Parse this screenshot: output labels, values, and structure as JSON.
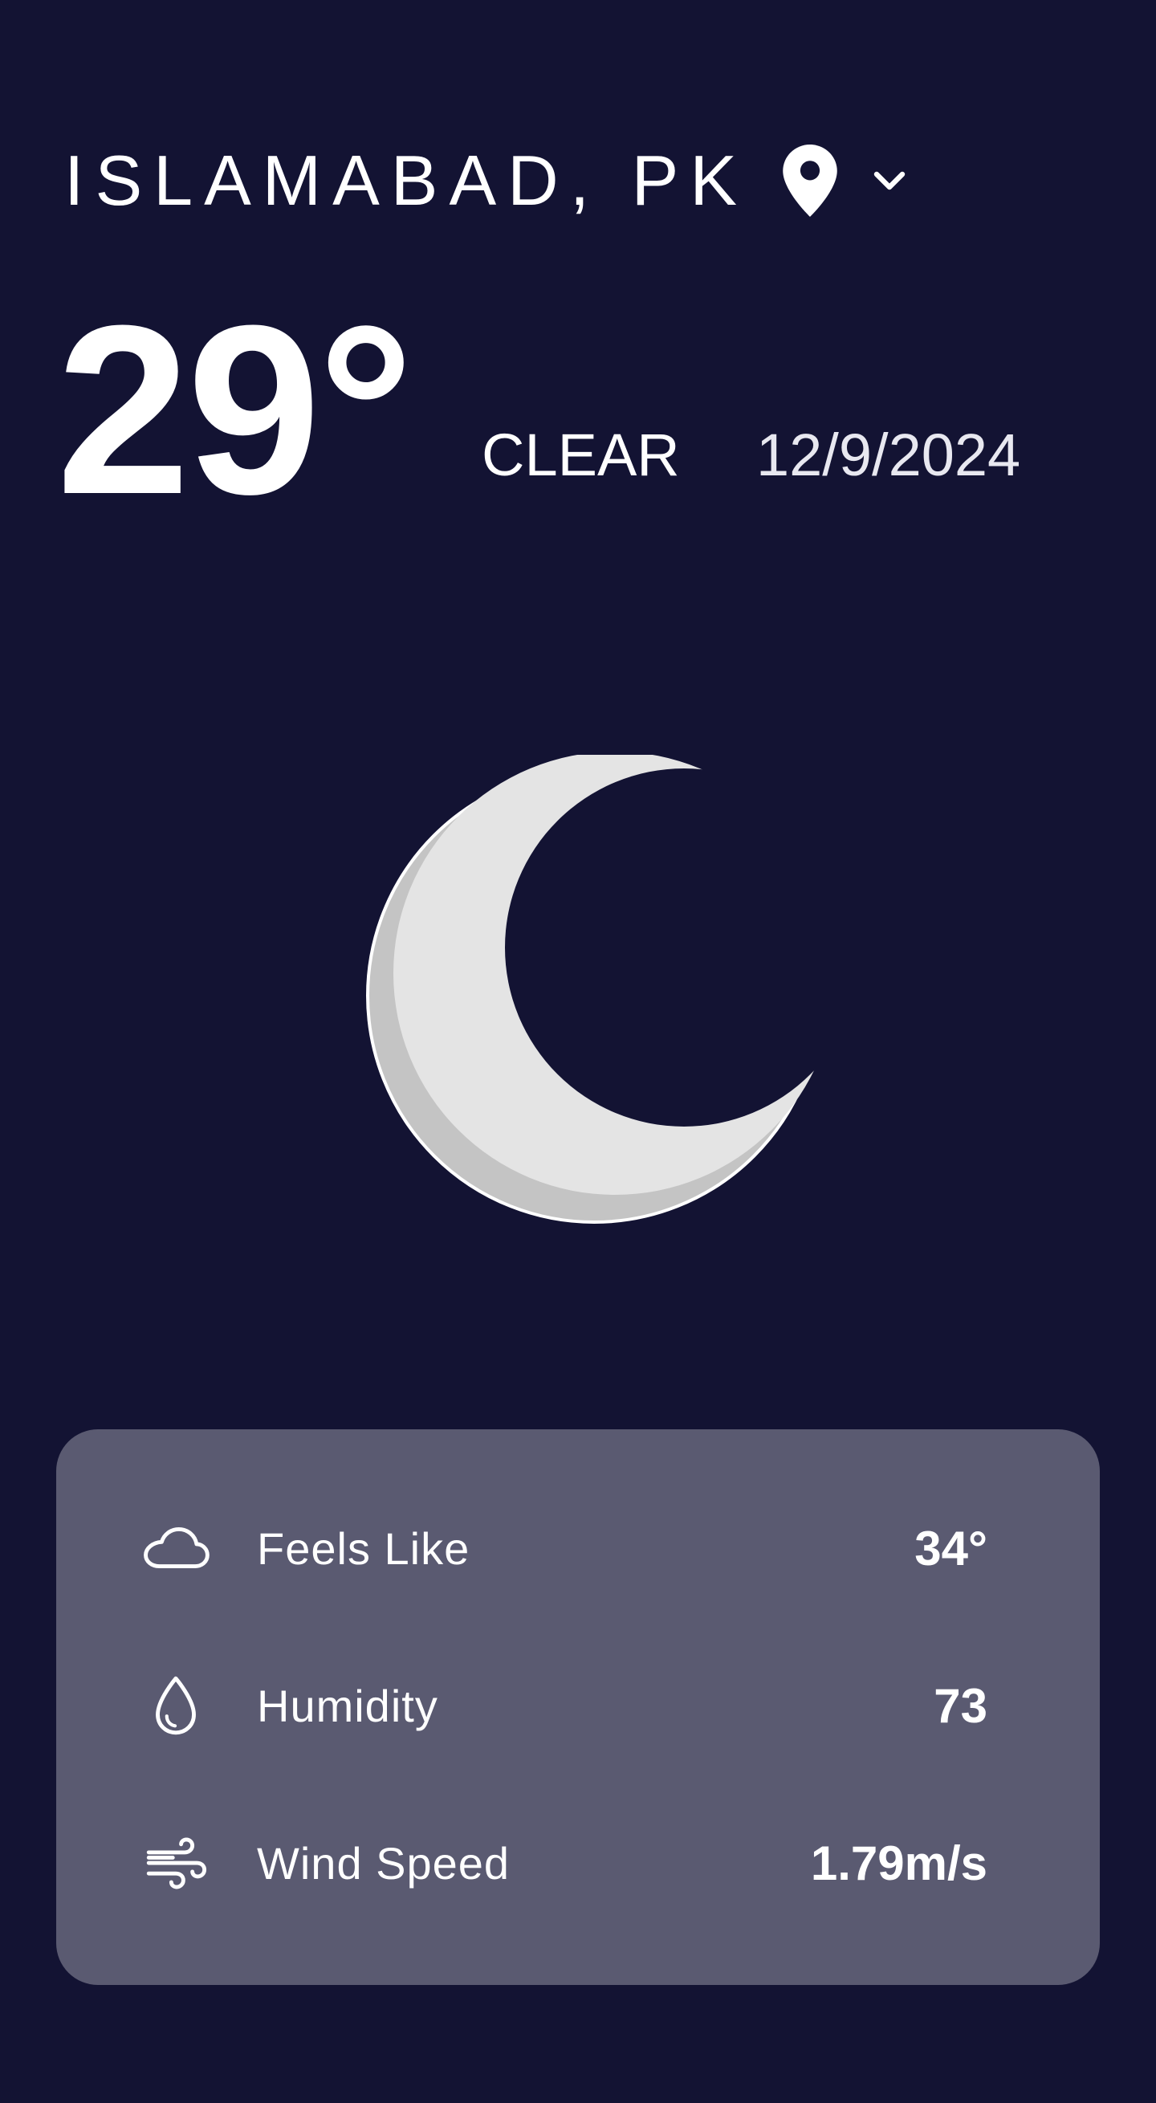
{
  "location": {
    "city": "ISLAMABAD, PK",
    "pin_icon": "map-pin-icon",
    "dropdown_icon": "chevron-down-icon"
  },
  "current": {
    "temperature": "29°",
    "condition": "CLEAR",
    "date": "12/9/2024",
    "weather_icon": "crescent-moon-icon"
  },
  "details": [
    {
      "icon": "cloud-icon",
      "label": "Feels Like",
      "value": "34°"
    },
    {
      "icon": "water-drop-icon",
      "label": "Humidity",
      "value": "73"
    },
    {
      "icon": "wind-icon",
      "label": "Wind Speed",
      "value": "1.79m/s"
    }
  ],
  "colors": {
    "background": "#131333",
    "card": "#5a5a71",
    "moon": "#e4e4e4",
    "moon_shadow": "#c4c4c4",
    "text": "#ffffff"
  }
}
